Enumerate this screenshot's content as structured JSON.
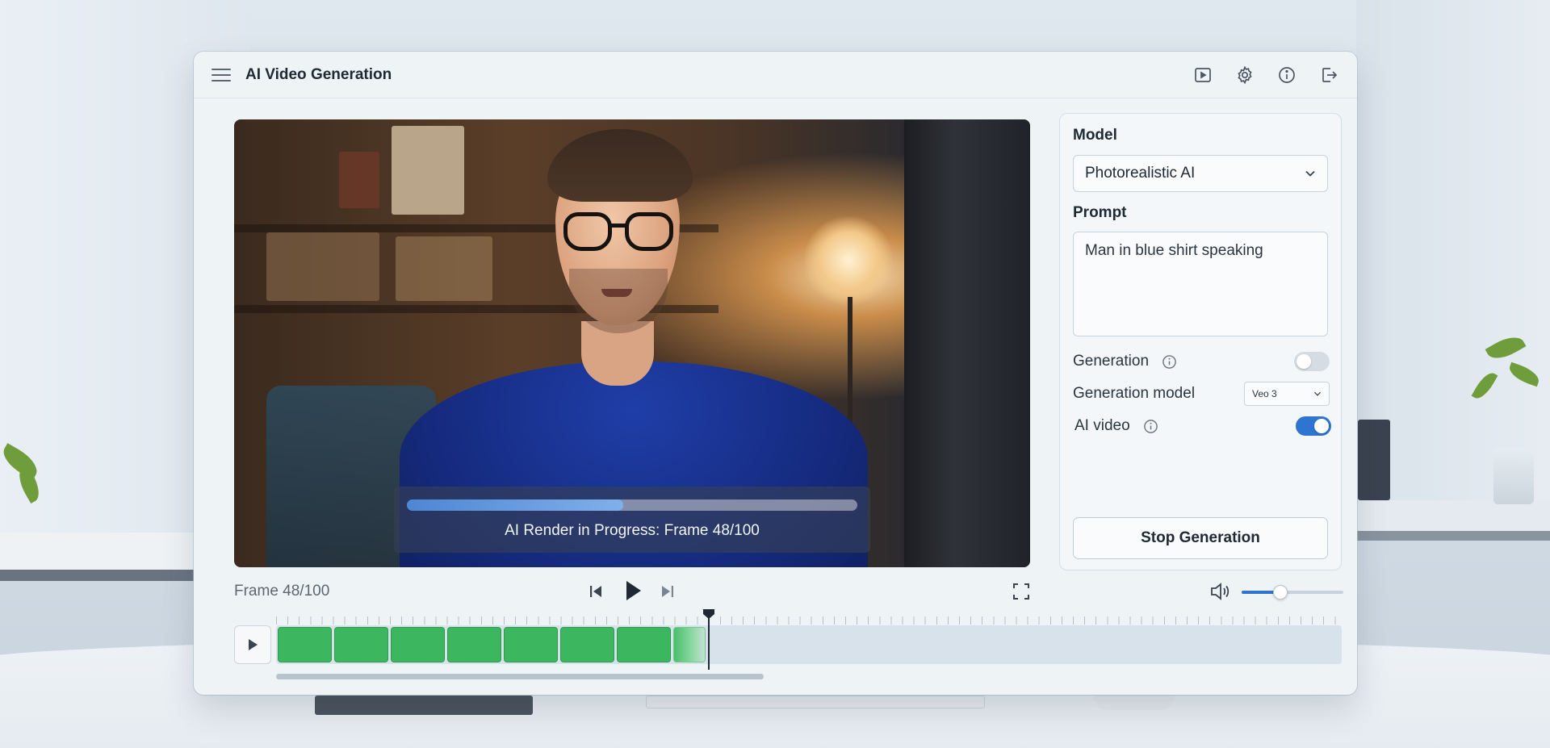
{
  "window": {
    "title": "AI Video Generation",
    "toolbar_icons": [
      "play-square-icon",
      "gear-icon",
      "info-icon",
      "logout-icon"
    ]
  },
  "player": {
    "render_status": "AI Render in Progress: Frame 48/100",
    "render_progress_fraction": 0.48,
    "frame_label": "Frame 48/100",
    "volume_fraction": 0.38
  },
  "timeline": {
    "completed_clips": 7,
    "partial_clip": true,
    "accent_clip_color": "#3cb65f"
  },
  "panel": {
    "model_label": "Model",
    "model_value": "Photorealistic AI",
    "prompt_label": "Prompt",
    "prompt_value": "Man in blue shirt speaking",
    "generation_label": "Generation",
    "generation_enabled": false,
    "generation_model_label": "Generation model",
    "generation_model_value": "Veo 3",
    "ai_video_label": "AI video",
    "ai_video_enabled": true,
    "stop_button": "Stop Generation"
  },
  "colors": {
    "accent_blue": "#2f74d0",
    "progress_blue": "#4f86d3",
    "clip_green": "#3cb65f"
  }
}
